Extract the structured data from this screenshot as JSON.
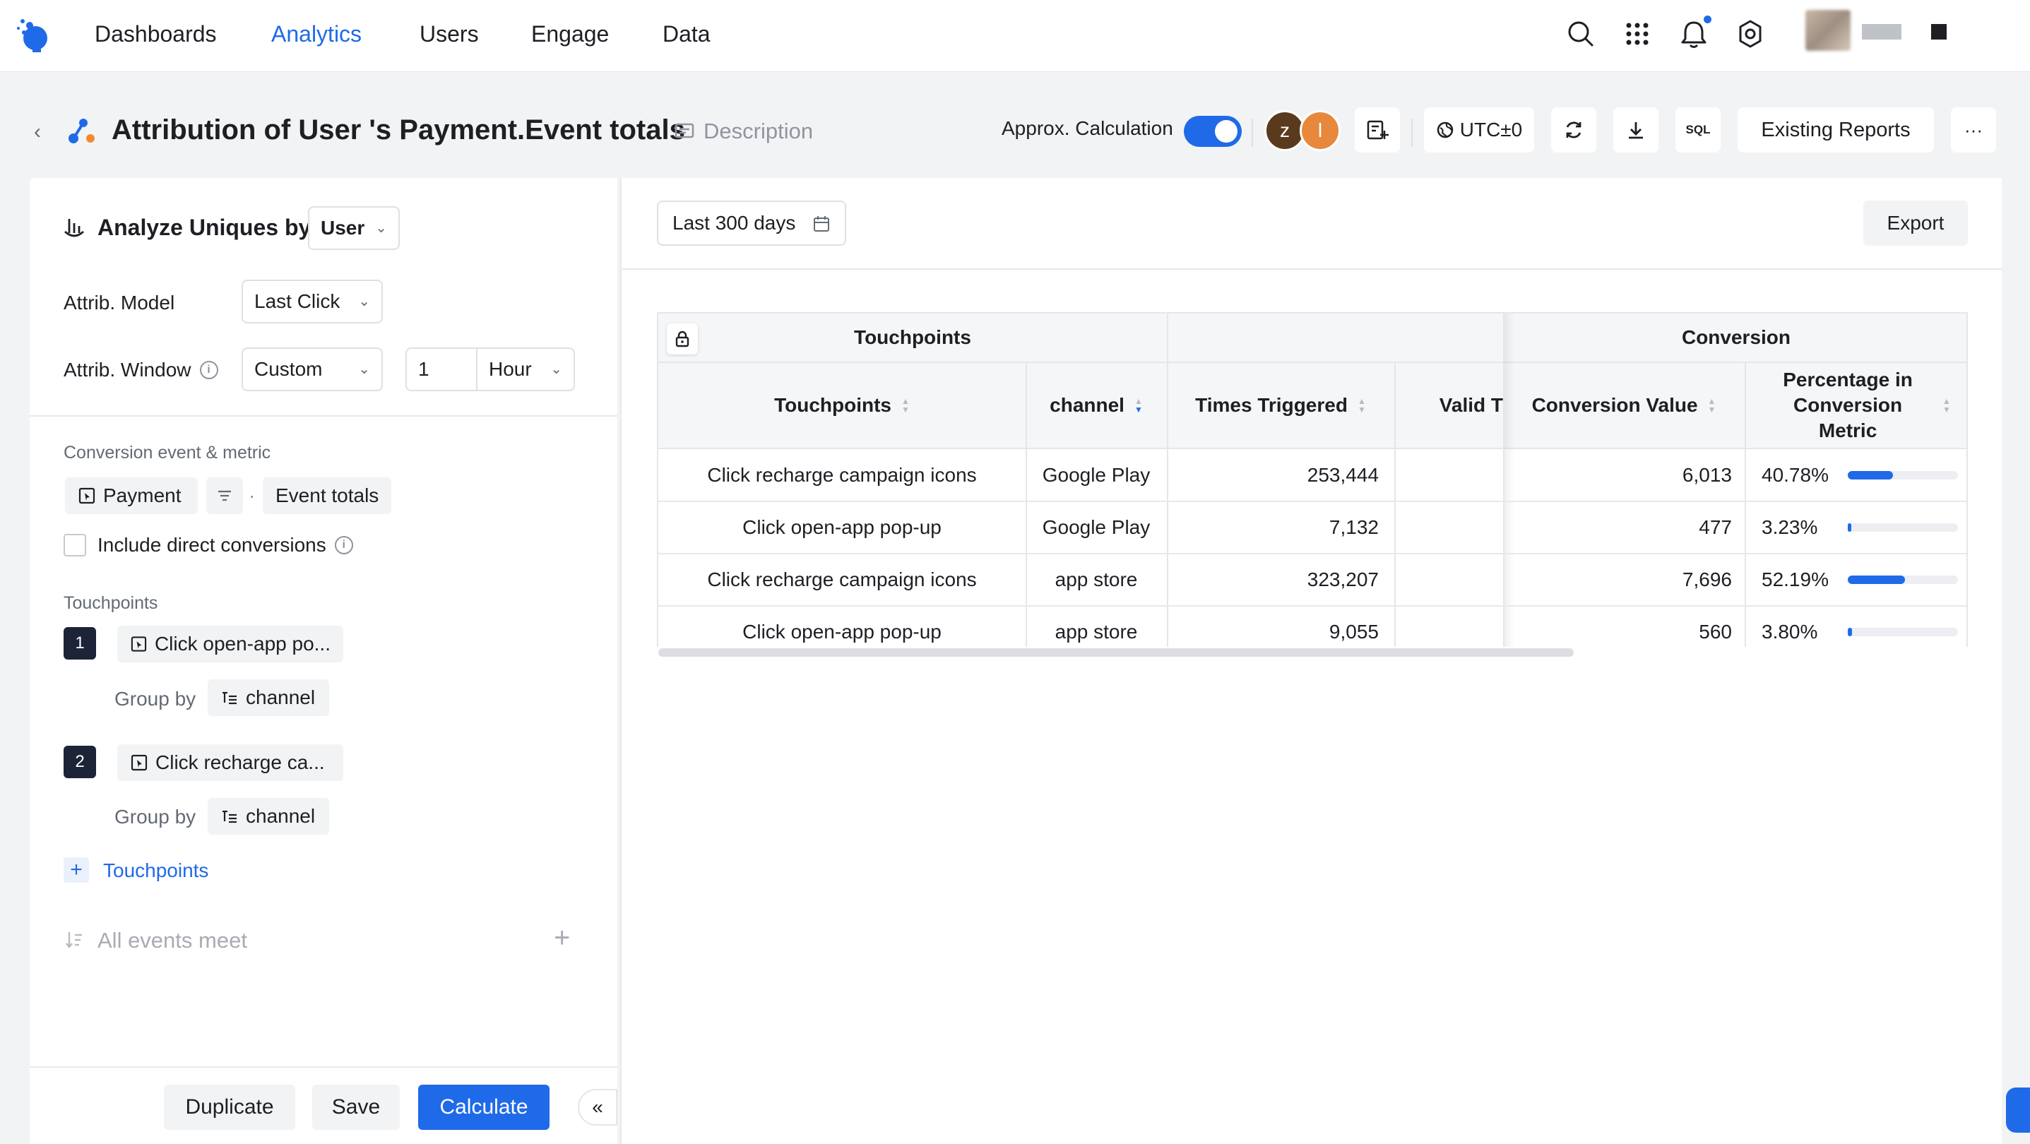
{
  "nav": {
    "items": [
      "Dashboards",
      "Analytics",
      "Users",
      "Engage",
      "Data"
    ],
    "active": "Analytics"
  },
  "header": {
    "title": "Attribution of User 's Payment.Event totals",
    "description_label": "Description",
    "approx_label": "Approx. Calculation",
    "approx_enabled": true,
    "collaborators": [
      "z",
      "l"
    ],
    "timezone": "UTC±0",
    "sql_label": "SQL",
    "existing_reports": "Existing Reports",
    "more": "···"
  },
  "config": {
    "analyze_label": "Analyze Uniques by",
    "analyze_value": "User",
    "model_label": "Attrib. Model",
    "model_value": "Last Click",
    "window_label": "Attrib. Window",
    "window_type": "Custom",
    "window_amount": "1",
    "window_unit": "Hour",
    "conversion_section": "Conversion event & metric",
    "conversion_event": "Payment",
    "conversion_metric": "Event totals",
    "include_direct": "Include direct conversions",
    "include_direct_checked": false,
    "touchpoints_section": "Touchpoints",
    "touchpoints": [
      {
        "index": "1",
        "event": "Click open-app po...",
        "group_by_label": "Group by",
        "group_by": "channel"
      },
      {
        "index": "2",
        "event": "Click recharge ca...",
        "group_by_label": "Group by",
        "group_by": "channel"
      }
    ],
    "add_touchpoints": "Touchpoints",
    "all_events": "All events meet"
  },
  "actions": {
    "duplicate": "Duplicate",
    "save": "Save",
    "calculate": "Calculate",
    "collapse": "«"
  },
  "results": {
    "date_range": "Last 300 days",
    "export": "Export",
    "group_headers": {
      "touchpoints": "Touchpoints",
      "conversion": "Conversion"
    },
    "columns": [
      "Touchpoints",
      "channel",
      "Times Triggered",
      "Valid T",
      "Conversion Value",
      "Percentage in Conversion Metric"
    ],
    "rows": [
      {
        "touchpoint": "Click recharge campaign icons",
        "channel": "Google Play",
        "times": "253,444",
        "value": "6,013",
        "pct": "40.78%",
        "pct_num": 40.78
      },
      {
        "touchpoint": "Click open-app pop-up",
        "channel": "Google Play",
        "times": "7,132",
        "value": "477",
        "pct": "3.23%",
        "pct_num": 3.23
      },
      {
        "touchpoint": "Click recharge campaign icons",
        "channel": "app store",
        "times": "323,207",
        "value": "7,696",
        "pct": "52.19%",
        "pct_num": 52.19
      },
      {
        "touchpoint": "Click open-app pop-up",
        "channel": "app store",
        "times": "9,055",
        "value": "560",
        "pct": "3.80%",
        "pct_num": 3.8
      }
    ]
  },
  "colors": {
    "accent": "#1f6ae8",
    "badge": "#1d2438"
  }
}
